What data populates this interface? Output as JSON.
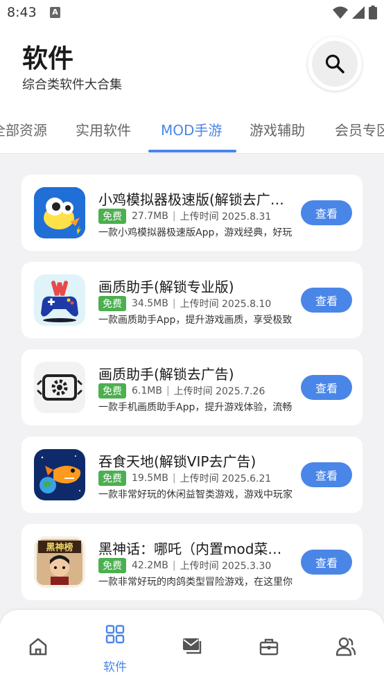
{
  "status_bar": {
    "time": "8:43"
  },
  "header": {
    "title": "软件",
    "subtitle": "综合类软件大合集"
  },
  "tabs": [
    {
      "label": "全部资源",
      "active": false
    },
    {
      "label": "实用软件",
      "active": false
    },
    {
      "label": "MOD手游",
      "active": true
    },
    {
      "label": "游戏辅助",
      "active": false
    },
    {
      "label": "会员专区",
      "active": false
    }
  ],
  "apps": [
    {
      "title": "小鸡模拟器极速版(解锁去广告)",
      "badge": "免费",
      "size": "27.7MB",
      "upload_time": "上传时间 2025.8.31",
      "desc": "一款小鸡模拟器极速版App，游戏经典，好玩",
      "button": "查看",
      "icon": "chicken-emulator-icon"
    },
    {
      "title": "画质助手(解锁专业版)",
      "badge": "免费",
      "size": "34.5MB",
      "upload_time": "上传时间 2025.8.10",
      "desc": "一款画质助手App，提升游戏画质，享受极致",
      "button": "查看",
      "icon": "gamepad-icon"
    },
    {
      "title": "画质助手(解锁去广告)",
      "badge": "免费",
      "size": "6.1MB",
      "upload_time": "上传时间 2025.7.26",
      "desc": "一款手机画质助手App，提升游戏体验，流畅",
      "button": "查看",
      "icon": "gear-screen-icon"
    },
    {
      "title": "吞食天地(解锁VIP去广告)",
      "badge": "免费",
      "size": "19.5MB",
      "upload_time": "上传时间 2025.6.21",
      "desc": "一款非常好玩的休闲益智类游戏，游戏中玩家",
      "button": "查看",
      "icon": "fish-game-icon"
    },
    {
      "title": "黑神话：哪吒（内置mod菜单）",
      "badge": "免费",
      "size": "42.2MB",
      "upload_time": "上传时间 2025.3.30",
      "desc": "一款非常好玩的肉鸽类型冒险游戏，在这里你",
      "button": "查看",
      "icon": "nezha-game-icon",
      "icon_text": "黑神榜"
    }
  ],
  "bottom_nav": [
    {
      "icon": "home-icon",
      "label": "",
      "active": false
    },
    {
      "icon": "grid-icon",
      "label": "软件",
      "active": true
    },
    {
      "icon": "mail-icon",
      "label": "",
      "active": false
    },
    {
      "icon": "toolbox-icon",
      "label": "",
      "active": false
    },
    {
      "icon": "users-icon",
      "label": "",
      "active": false
    }
  ],
  "colors": {
    "accent": "#4a86e8",
    "free_badge": "#4caf50",
    "background": "#f2f2f4"
  }
}
